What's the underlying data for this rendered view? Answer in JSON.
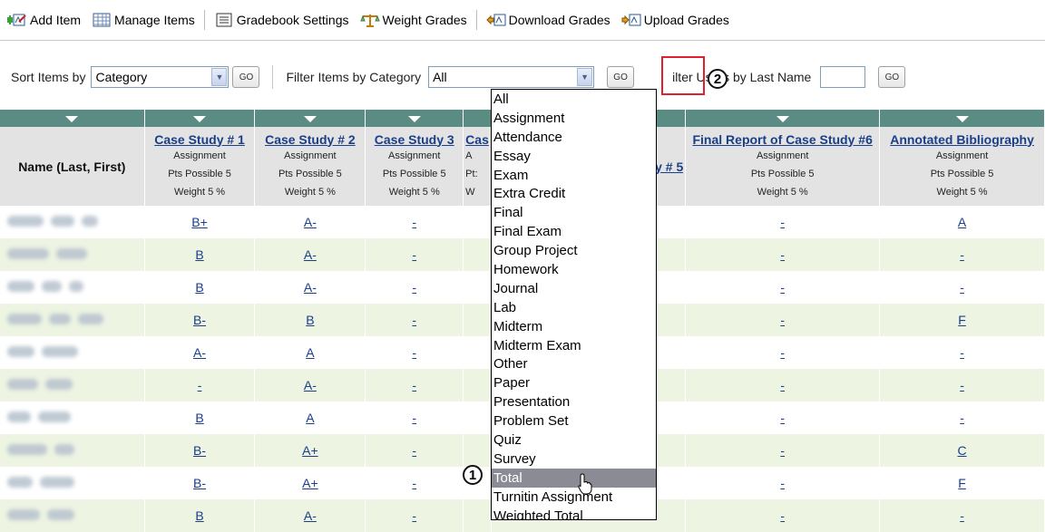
{
  "toolbar": {
    "add_item": "Add Item",
    "manage_items": "Manage Items",
    "gradebook_settings": "Gradebook Settings",
    "weight_grades": "Weight Grades",
    "download_grades": "Download Grades",
    "upload_grades": "Upload Grades"
  },
  "filters": {
    "sort_label": "Sort Items by",
    "sort_value": "Category",
    "go": "GO",
    "filter_category_label": "Filter Items by Category",
    "filter_category_value": "All",
    "filter_users_label": "ilter Users by Last Name"
  },
  "callouts": {
    "one": "1",
    "two": "2"
  },
  "table": {
    "name_header": "Name (Last, First)",
    "columns": [
      {
        "title": "Case Study # 1",
        "type": "Assignment",
        "pts": "Pts Possible 5",
        "weight": "Weight 5 %"
      },
      {
        "title": "Case Study # 2",
        "type": "Assignment",
        "pts": "Pts Possible 5",
        "weight": "Weight 5 %"
      },
      {
        "title": "Case Study 3",
        "type": "Assignment",
        "pts": "Pts Possible 5",
        "weight": "Weight 5 %"
      },
      {
        "title": "Cas",
        "type": "A",
        "pts": "Pt:",
        "weight": "W"
      },
      {
        "title": "y # 5",
        "type": "",
        "pts": "",
        "weight": ""
      },
      {
        "title": "Final Report of Case Study #6",
        "type": "Assignment",
        "pts": "Pts Possible 5",
        "weight": "Weight 5 %"
      },
      {
        "title": "Annotated Bibliography",
        "type": "Assignment",
        "pts": "Pts Possible 5",
        "weight": "Weight 5 %"
      }
    ],
    "rows": [
      {
        "grades": [
          "B+",
          "A-",
          "-",
          "",
          "",
          "-",
          "A"
        ]
      },
      {
        "grades": [
          "B",
          "A-",
          "-",
          "",
          "",
          "-",
          "-"
        ]
      },
      {
        "grades": [
          "B",
          "A-",
          "-",
          "",
          "",
          "-",
          "-"
        ]
      },
      {
        "grades": [
          "B-",
          "B",
          "-",
          "",
          "",
          "-",
          "F"
        ]
      },
      {
        "grades": [
          "A-",
          "A",
          "-",
          "",
          "",
          "-",
          "-"
        ]
      },
      {
        "grades": [
          "-",
          "A-",
          "-",
          "",
          "",
          "-",
          "-"
        ]
      },
      {
        "grades": [
          "B",
          "A",
          "-",
          "",
          "",
          "-",
          "-"
        ]
      },
      {
        "grades": [
          "B-",
          "A+",
          "-",
          "",
          "",
          "-",
          "C"
        ]
      },
      {
        "grades": [
          "B-",
          "A+",
          "-",
          "",
          "",
          "-",
          "F"
        ]
      },
      {
        "grades": [
          "B",
          "A-",
          "-",
          "",
          "",
          "-",
          "-"
        ]
      }
    ]
  },
  "dropdown": {
    "options": [
      "All",
      "Assignment",
      "Attendance",
      "Essay",
      "Exam",
      "Extra Credit",
      "Final",
      "Final Exam",
      "Group Project",
      "Homework",
      "Journal",
      "Lab",
      "Midterm",
      "Midterm Exam",
      "Other",
      "Paper",
      "Presentation",
      "Problem Set",
      "Quiz",
      "Survey",
      "Total",
      "Turnitin Assignment",
      "Weighted Total"
    ],
    "highlighted": "Total"
  },
  "colors": {
    "header_bar": "#5a8c84",
    "header_bg": "#e3e3e3",
    "row_alt": "#eef4e2",
    "link": "#1a3e8a",
    "highlight_box": "#e0202e"
  }
}
